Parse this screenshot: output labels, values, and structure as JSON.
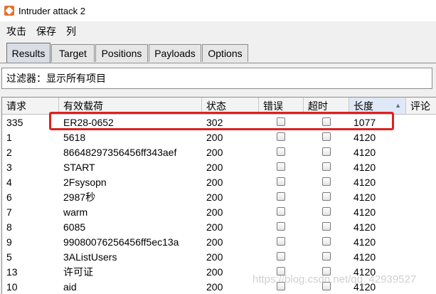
{
  "window": {
    "title": "Intruder attack 2"
  },
  "menu": [
    "攻击",
    "保存",
    "列"
  ],
  "tabs": [
    "Results",
    "Target",
    "Positions",
    "Payloads",
    "Options"
  ],
  "active_tab": "Results",
  "filter": {
    "text": "过滤器：显示所有项目"
  },
  "table": {
    "columns": [
      "请求",
      "有效载荷",
      "状态",
      "错误",
      "超时",
      "长度",
      "评论"
    ],
    "sorted_column": "长度",
    "rows": [
      {
        "request": "335",
        "payload": "ER28-0652",
        "status": "302",
        "length": "1077"
      },
      {
        "request": "1",
        "payload": "5618",
        "status": "200",
        "length": "4120"
      },
      {
        "request": "2",
        "payload": "86648297356456ff343aef",
        "status": "200",
        "length": "4120"
      },
      {
        "request": "3",
        "payload": "START",
        "status": "200",
        "length": "4120"
      },
      {
        "request": "4",
        "payload": "2Fsysopn",
        "status": "200",
        "length": "4120"
      },
      {
        "request": "6",
        "payload": "2987秒",
        "status": "200",
        "length": "4120"
      },
      {
        "request": "7",
        "payload": "warm",
        "status": "200",
        "length": "4120"
      },
      {
        "request": "8",
        "payload": "6085",
        "status": "200",
        "length": "4120"
      },
      {
        "request": "9",
        "payload": "99080076256456ff5ec13a",
        "status": "200",
        "length": "4120"
      },
      {
        "request": "5",
        "payload": "3AListUsers",
        "status": "200",
        "length": "4120"
      },
      {
        "request": "13",
        "payload": "许可证",
        "status": "200",
        "length": "4120"
      },
      {
        "request": "10",
        "payload": "aid",
        "status": "200",
        "length": "4120"
      }
    ]
  },
  "watermark": "https://blog.csdn.net/qq_42939527"
}
